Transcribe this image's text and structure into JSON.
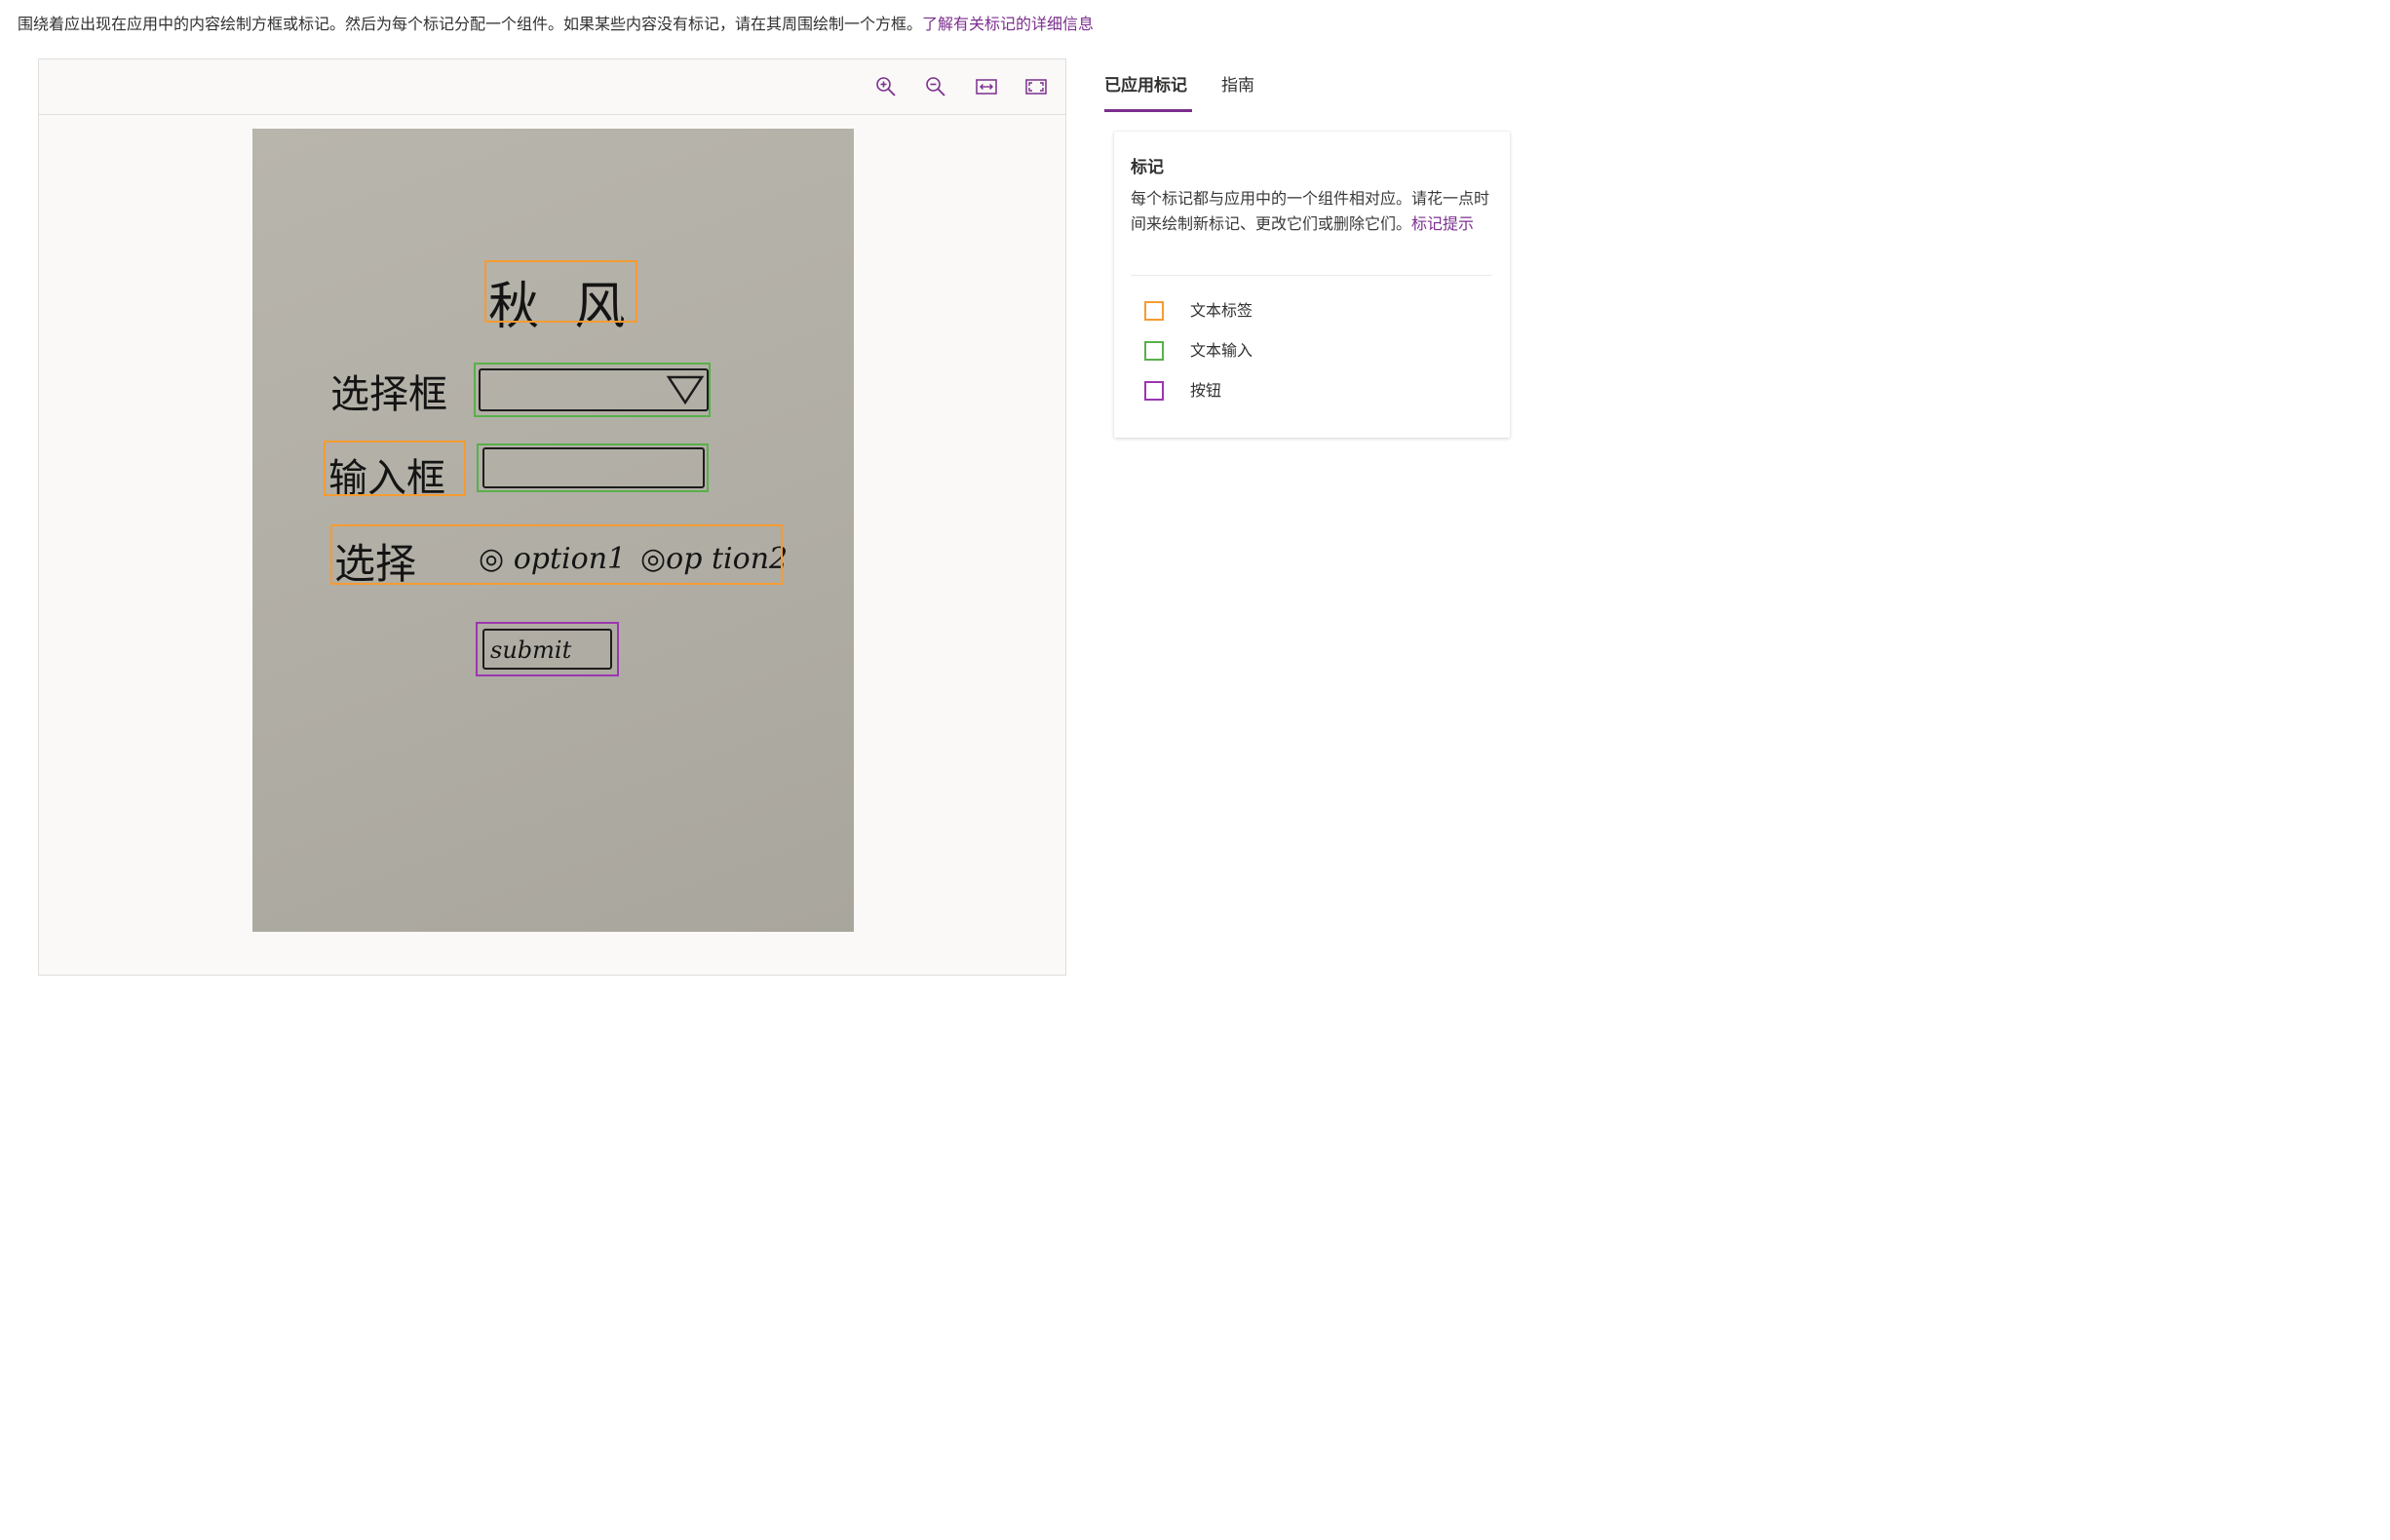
{
  "instruction": {
    "text": "围绕着应出现在应用中的内容绘制方框或标记。然后为每个标记分配一个组件。如果某些内容没有标记，请在其周围绘制一个方框。",
    "link": "了解有关标记的详细信息"
  },
  "toolbar": {
    "buttons": [
      {
        "name": "zoom-in-icon"
      },
      {
        "name": "zoom-out-icon"
      },
      {
        "name": "fit-width-icon"
      },
      {
        "name": "fit-screen-icon"
      }
    ]
  },
  "sketch": {
    "title": "秋 风",
    "select_label": "选择框",
    "input_label": "输入框",
    "radio_label": "选择",
    "option1": "◎ option1",
    "option2": "◎op tion2",
    "submit": "submit"
  },
  "tabs": {
    "applied": "已应用标记",
    "guide": "指南"
  },
  "panel": {
    "title": "标记",
    "description": "每个标记都与应用中的一个组件相对应。请花一点时间来绘制新标记、更改它们或删除它们。",
    "hint_link": "标记提示",
    "legend": [
      {
        "label": "文本标签",
        "color": "#f59b32"
      },
      {
        "label": "文本输入",
        "color": "#58b04a"
      },
      {
        "label": "按钮",
        "color": "#9b36b0"
      }
    ]
  },
  "colors": {
    "accent": "#7b2f8e",
    "text_label": "#f59b32",
    "text_input": "#58b04a",
    "button": "#9b36b0"
  }
}
